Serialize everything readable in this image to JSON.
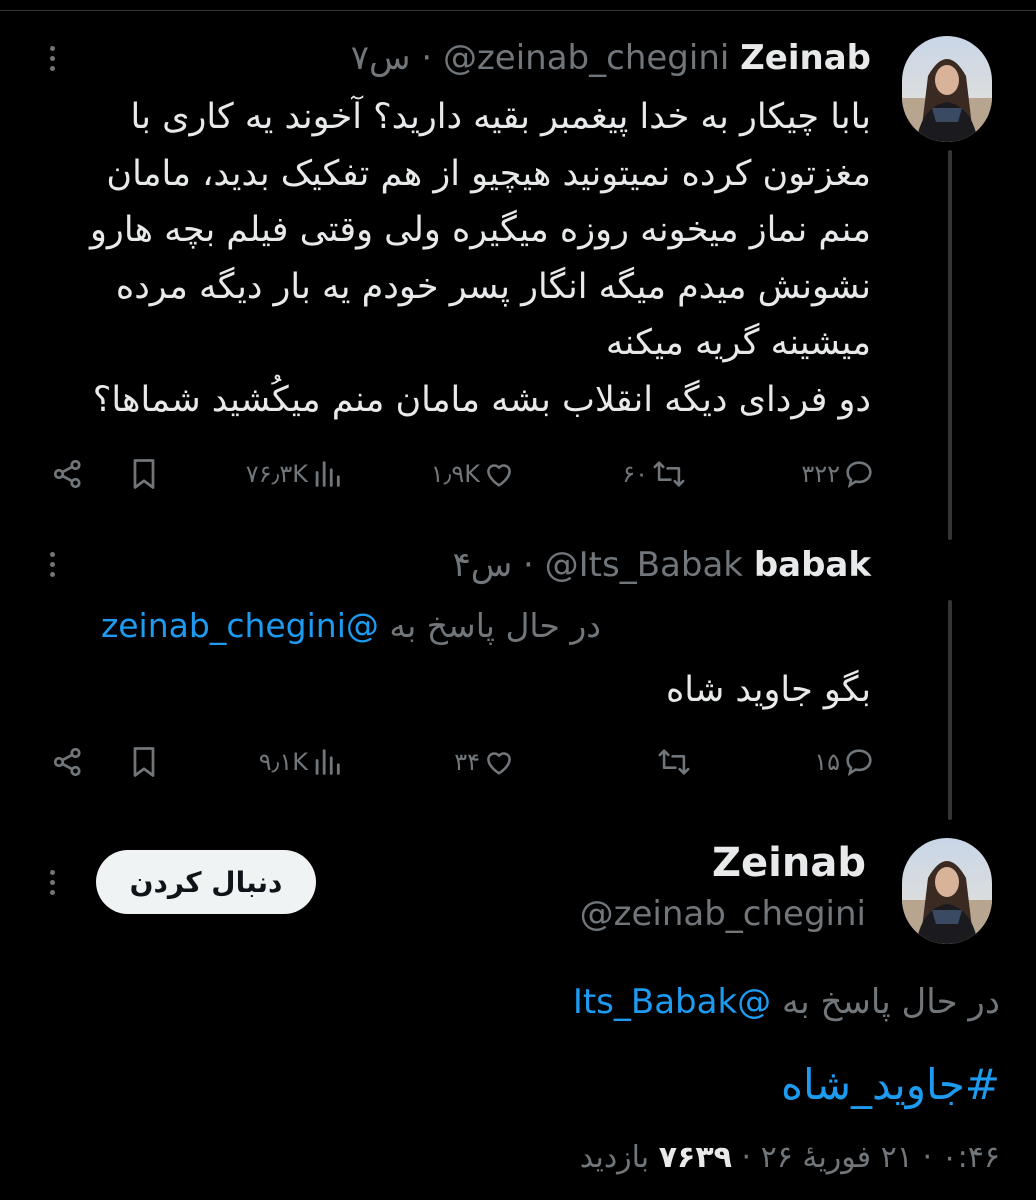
{
  "tweet1": {
    "name": "Zeinab",
    "handle": "@zeinab_chegini",
    "separator": "·",
    "time": "۷س",
    "text": "بابا چیکار به خدا پیغمبر بقیه دارید؟ آخوند یه کاری با\nمغزتون کرده نمیتونید هیچیو از هم تفکیک بدید، مامان\nمنم نماز میخونه روزه میگیره ولی وقتی فیلم بچه هارو\nنشونش میدم میگه انگار پسر خودم یه بار دیگه مرده\nمیشینه گریه میکنه\nدو فردای دیگه انقلاب بشه مامان منم میکُشید شماها؟",
    "replies": "۳۲۲",
    "retweets": "۶۰",
    "likes": "۱٫۹K",
    "views": "۷۶٫۳K"
  },
  "tweet2": {
    "name": "babak",
    "handle": "@Its_Babak",
    "separator": "·",
    "time": "۴س",
    "replying_prefix": "در حال پاسخ به",
    "replying_to": "@zeinab_chegini",
    "text": "بگو جاوید شاه",
    "replies": "۱۵",
    "retweets": "",
    "likes": "۳۴",
    "views": "۹٫۱K"
  },
  "tweet3": {
    "name": "Zeinab",
    "handle": "@zeinab_chegini",
    "follow_label": "دنبال کردن",
    "replying_prefix": "در حال پاسخ به",
    "replying_to": "@Its_Babak",
    "hashtag": "#جاوید_شاه",
    "time": "۰:۴۶",
    "date": "۲۱ فوریهٔ ۲۶",
    "separator": "·",
    "views": "۷۶۳۹",
    "views_label": "بازدید"
  },
  "icons": [
    "more-icon",
    "reply-icon",
    "retweet-icon",
    "like-icon",
    "views-icon",
    "bookmark-icon",
    "share-icon"
  ],
  "colors": {
    "background": "#000000",
    "text": "#e7e9ea",
    "muted": "#71767b",
    "accent": "#1d9bf0",
    "follow_button": "#eff3f4"
  }
}
